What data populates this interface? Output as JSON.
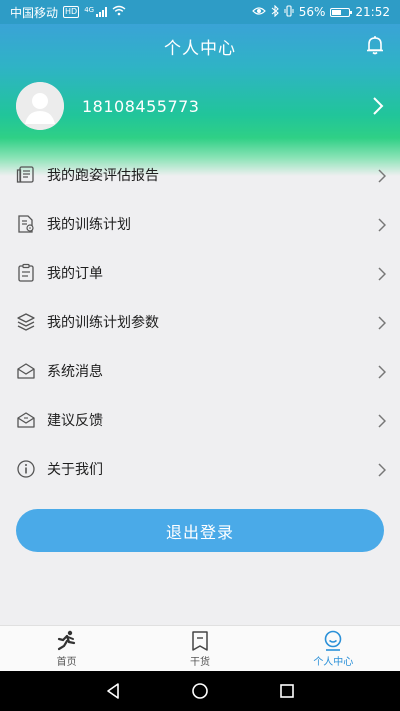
{
  "status_bar": {
    "carrier": "中国移动",
    "hd": "HD",
    "network": "4G",
    "battery": "56%",
    "battery_level": 0.56,
    "time": "21:52"
  },
  "header": {
    "title": "个人中心"
  },
  "profile": {
    "phone": "18108455773"
  },
  "menu": [
    {
      "label": "我的跑姿评估报告",
      "icon": "report-icon"
    },
    {
      "label": "我的训练计划",
      "icon": "plan-icon"
    },
    {
      "label": "我的订单",
      "icon": "order-icon"
    },
    {
      "label": "我的训练计划参数",
      "icon": "layers-icon"
    },
    {
      "label": "系统消息",
      "icon": "message-icon"
    },
    {
      "label": "建议反馈",
      "icon": "feedback-icon"
    },
    {
      "label": "关于我们",
      "icon": "info-icon"
    }
  ],
  "logout_label": "退出登录",
  "tabs": [
    {
      "label": "首页",
      "icon": "runner-icon",
      "active": false
    },
    {
      "label": "干货",
      "icon": "bookmark-icon",
      "active": false
    },
    {
      "label": "个人中心",
      "icon": "profile-icon",
      "active": true
    }
  ],
  "colors": {
    "accent": "#4aaae8",
    "active_tab": "#2a90d8",
    "header_top": "#3aa3d6",
    "header_mid": "#21c59a"
  }
}
